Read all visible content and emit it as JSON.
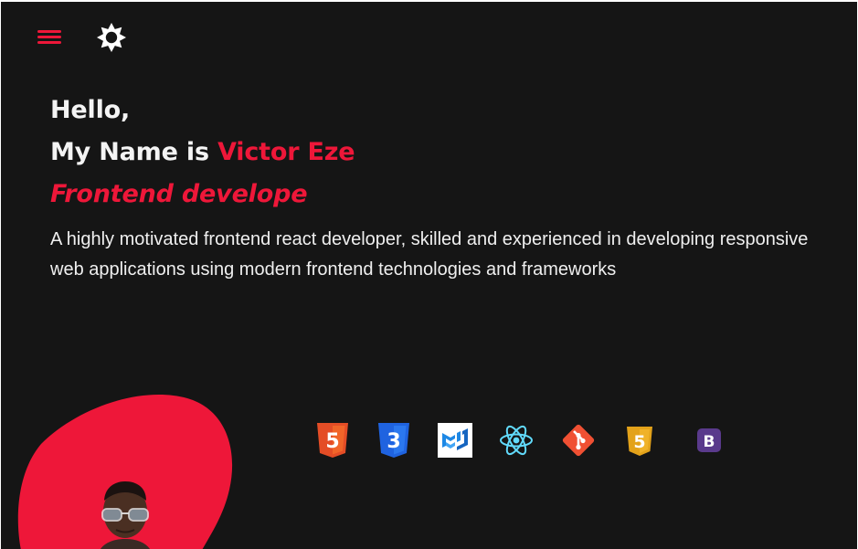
{
  "colors": {
    "accent": "#ee1739",
    "background": "#151515",
    "text": "#f2f2f2"
  },
  "header": {
    "menu_icon": "hamburger-menu-icon",
    "theme_icon": "sun-icon"
  },
  "hero": {
    "greeting": "Hello,",
    "name_prefix": "My Name is ",
    "name": "Victor Eze",
    "role": "Frontend develope",
    "description": "A highly motivated frontend react developer, skilled and experienced in developing responsive web applications using modern frontend technologies and frameworks"
  },
  "tech_icons": [
    {
      "name": "html5-icon",
      "glyph": "5",
      "color": "#e44d26"
    },
    {
      "name": "css3-icon",
      "glyph": "3",
      "color": "#1f63e0"
    },
    {
      "name": "mui-icon",
      "glyph": "MUI",
      "color": "#1e88e5"
    },
    {
      "name": "react-icon",
      "glyph": "react",
      "color": "#61dafb"
    },
    {
      "name": "git-icon",
      "glyph": "git",
      "color": "#f05033"
    },
    {
      "name": "javascript-icon",
      "glyph": "5",
      "color": "#e3a21a"
    },
    {
      "name": "bootstrap-icon",
      "glyph": "B",
      "color": "#5a3a8c"
    }
  ]
}
